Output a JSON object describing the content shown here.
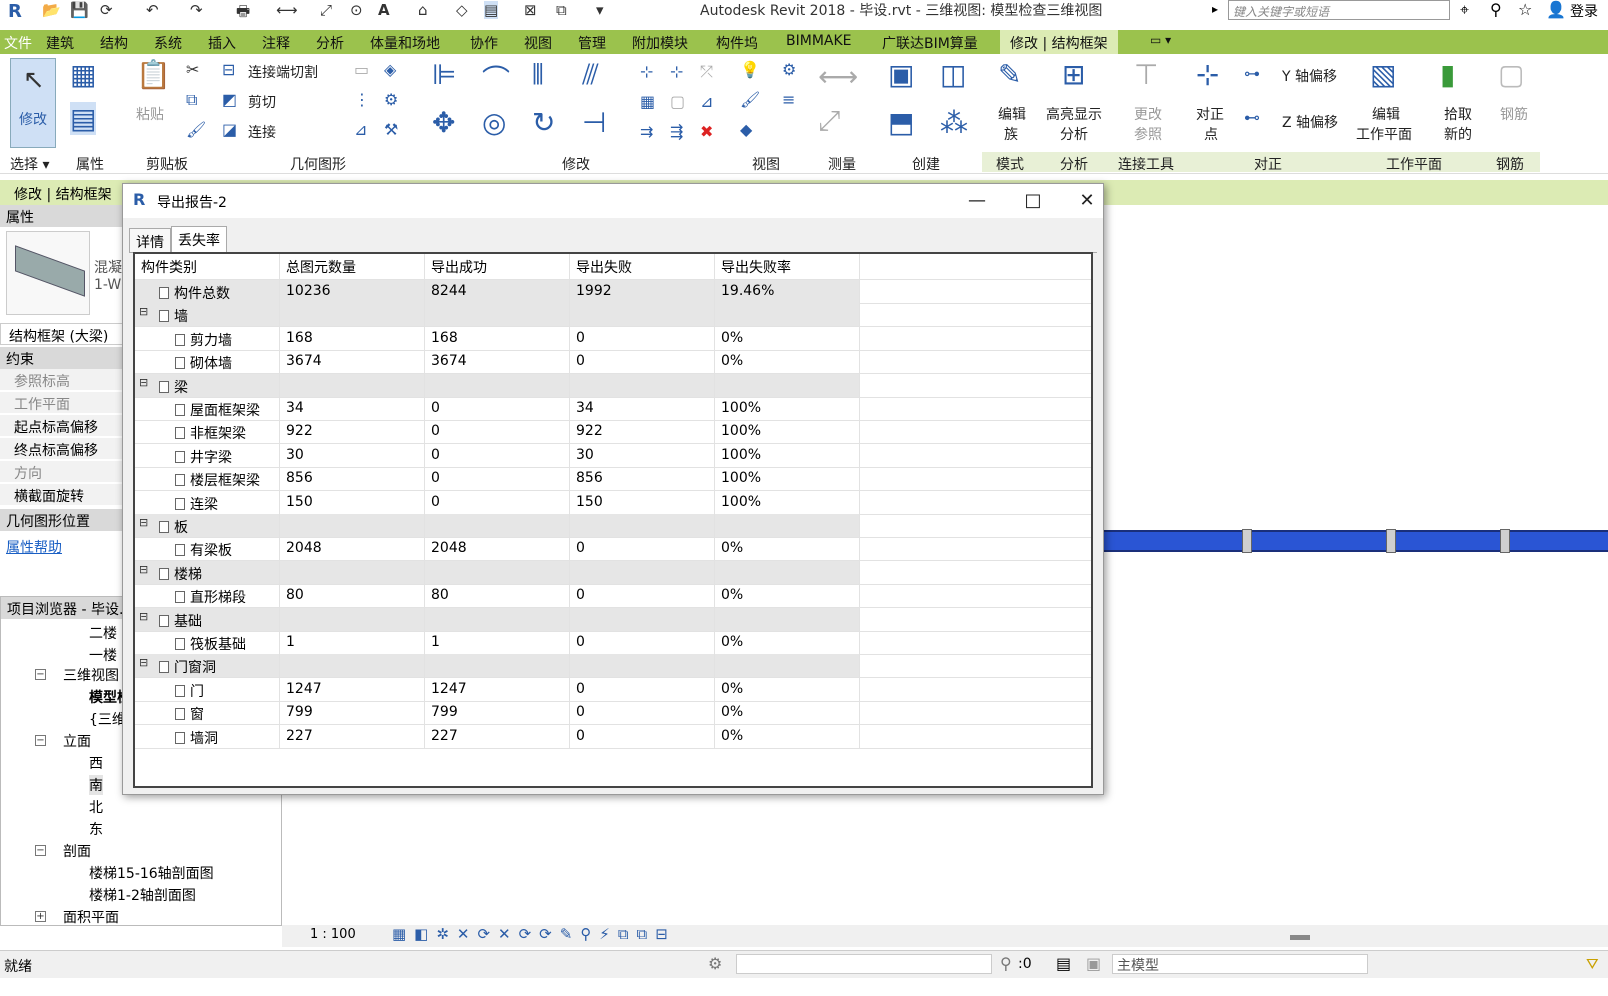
{
  "app": {
    "title": "Autodesk Revit 2018 -    毕设.rvt - 三维视图: 模型检查三维视图",
    "search_placeholder": "键入关键字或短语",
    "login": "登录"
  },
  "menu": [
    "文件",
    "建筑",
    "结构",
    "系统",
    "插入",
    "注释",
    "分析",
    "体量和场地",
    "协作",
    "视图",
    "管理",
    "附加模块",
    "构件坞",
    "BIMMAKE",
    "广联达BIM算量",
    "修改 | 结构框架"
  ],
  "ribbon": {
    "modify_label": "修改",
    "paste_label": "粘贴",
    "join_cut": "连接端切割",
    "cut": "剪切",
    "join": "连接",
    "edit_family": "编辑\n族",
    "edit_family_l1": "编辑",
    "edit_family_l2": "族",
    "highlight_l1": "高亮显示",
    "highlight_l2": "分析",
    "change_ref_l1": "更改",
    "change_ref_l2": "参照",
    "align_point_l1": "对正",
    "align_point_l2": "点",
    "y_offset": "Y 轴偏移",
    "z_offset": "Z 轴偏移",
    "edit_wp_l1": "编辑",
    "edit_wp_l2": "工作平面",
    "pick_new_l1": "拾取",
    "pick_new_l2": "新的",
    "rebar": "钢筋",
    "groups": [
      "选择 ▾",
      "属性",
      "剪贴板",
      "几何图形",
      "修改",
      "视图",
      "测量",
      "创建",
      "模式",
      "分析",
      "连接工具",
      "对正",
      "工作平面",
      "钢筋"
    ]
  },
  "context_bar": "修改 | 结构框架",
  "properties": {
    "header": "属性",
    "type_line1": "混凝",
    "type_line2": "1-W",
    "instance": "结构框架 (大梁) (",
    "rows": [
      {
        "label": "约束",
        "kind": "header"
      },
      {
        "label": "参照标高",
        "kind": "dim"
      },
      {
        "label": "工作平面",
        "kind": "dim"
      },
      {
        "label": "起点标高偏移",
        "kind": "bold"
      },
      {
        "label": "终点标高偏移",
        "kind": "bold"
      },
      {
        "label": "方向",
        "kind": "dim"
      },
      {
        "label": "横截面旋转",
        "kind": "bold"
      },
      {
        "label": "几何图形位置",
        "kind": "header"
      }
    ],
    "help": "属性帮助"
  },
  "browser": {
    "header": "项目浏览器 - 毕设.",
    "items": [
      {
        "label": "二楼",
        "level": 3
      },
      {
        "label": "一楼",
        "level": 3
      },
      {
        "label": "三维视图",
        "level": 2,
        "toggle": "−"
      },
      {
        "label": "模型检",
        "level": 3,
        "bold": true
      },
      {
        "label": "{三维",
        "level": 3
      },
      {
        "label": "立面",
        "level": 2,
        "toggle": "−"
      },
      {
        "label": "西",
        "level": 3
      },
      {
        "label": "南",
        "level": 3
      },
      {
        "label": "北",
        "level": 3
      },
      {
        "label": "东",
        "level": 3
      },
      {
        "label": "剖面",
        "level": 2,
        "toggle": "−"
      },
      {
        "label": "楼梯15-16轴剖面图",
        "level": 3
      },
      {
        "label": "楼梯1-2轴剖面图",
        "level": 3
      },
      {
        "label": "面积平面",
        "level": 2,
        "toggle": "+"
      }
    ]
  },
  "viewbar": {
    "scale": "1 : 100"
  },
  "status": {
    "ready": "就绪",
    "count": ":0",
    "model": "主模型"
  },
  "dialog": {
    "title": "导出报告-2",
    "tabs": [
      "详情",
      "丢失率"
    ],
    "selected_tab": 1,
    "columns": [
      "构件类别",
      "总图元数量",
      "导出成功",
      "导出失败",
      "导出失败率"
    ],
    "rows": [
      {
        "name": "构件总数",
        "level": 0,
        "values": [
          "10236",
          "8244",
          "1992",
          "19.46%"
        ],
        "shade": true
      },
      {
        "name": "墙",
        "level": 0,
        "group": true
      },
      {
        "name": "剪力墙",
        "level": 1,
        "values": [
          "168",
          "168",
          "0",
          "0%"
        ]
      },
      {
        "name": "砌体墙",
        "level": 1,
        "values": [
          "3674",
          "3674",
          "0",
          "0%"
        ]
      },
      {
        "name": "梁",
        "level": 0,
        "group": true
      },
      {
        "name": "屋面框架梁",
        "level": 1,
        "values": [
          "34",
          "0",
          "34",
          "100%"
        ]
      },
      {
        "name": "非框架梁",
        "level": 1,
        "values": [
          "922",
          "0",
          "922",
          "100%"
        ]
      },
      {
        "name": "井字梁",
        "level": 1,
        "values": [
          "30",
          "0",
          "30",
          "100%"
        ]
      },
      {
        "name": "楼层框架梁",
        "level": 1,
        "values": [
          "856",
          "0",
          "856",
          "100%"
        ]
      },
      {
        "name": "连梁",
        "level": 1,
        "values": [
          "150",
          "0",
          "150",
          "100%"
        ]
      },
      {
        "name": "板",
        "level": 0,
        "group": true
      },
      {
        "name": "有梁板",
        "level": 1,
        "values": [
          "2048",
          "2048",
          "0",
          "0%"
        ]
      },
      {
        "name": "楼梯",
        "level": 0,
        "group": true
      },
      {
        "name": "直形梯段",
        "level": 1,
        "values": [
          "80",
          "80",
          "0",
          "0%"
        ]
      },
      {
        "name": "基础",
        "level": 0,
        "group": true
      },
      {
        "name": "筏板基础",
        "level": 1,
        "values": [
          "1",
          "1",
          "0",
          "0%"
        ]
      },
      {
        "name": "门窗洞",
        "level": 0,
        "group": true
      },
      {
        "name": "门",
        "level": 1,
        "values": [
          "1247",
          "1247",
          "0",
          "0%"
        ]
      },
      {
        "name": "窗",
        "level": 1,
        "values": [
          "799",
          "799",
          "0",
          "0%"
        ]
      },
      {
        "name": "墙洞",
        "level": 1,
        "values": [
          "227",
          "227",
          "0",
          "0%"
        ]
      }
    ]
  },
  "colors": {
    "menu_bg": "#9bc24d",
    "context_bg": "#dcebb4",
    "beam": "#2a55d4",
    "revit_blue": "#2b5da8"
  }
}
